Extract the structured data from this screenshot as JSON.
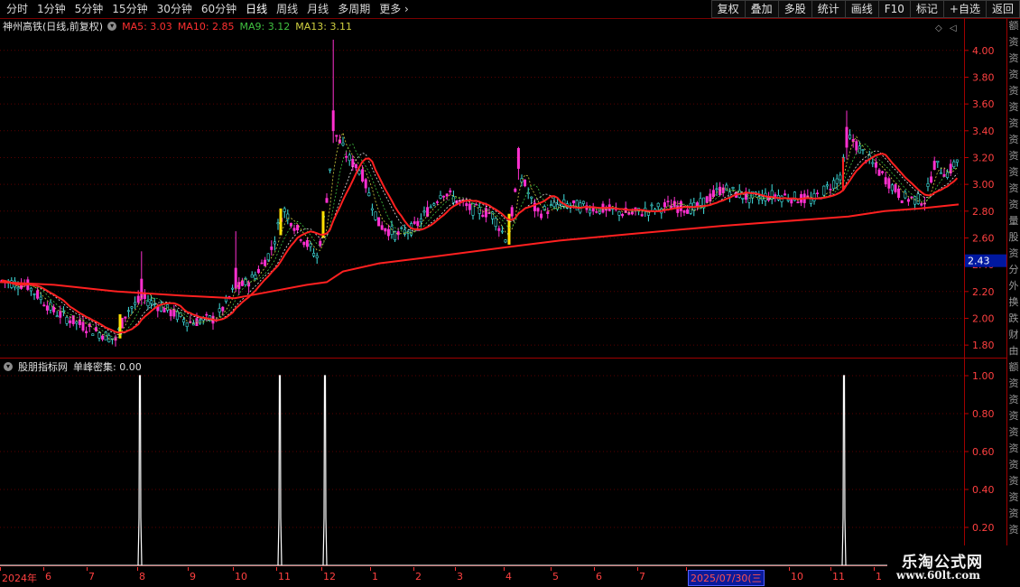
{
  "toolbar": {
    "periods": [
      "分时",
      "1分钟",
      "5分钟",
      "15分钟",
      "30分钟",
      "60分钟",
      "日线",
      "周线",
      "月线",
      "多周期",
      "更多"
    ],
    "active_period": "日线",
    "buttons": [
      "复权",
      "叠加",
      "多股",
      "统计",
      "画线",
      "F10",
      "标记",
      "+自选",
      "返回"
    ]
  },
  "main_legend": {
    "stock": "神州高铁(日线,前复权)",
    "ma5": "MA5: 3.03",
    "ma10": "MA10: 2.85",
    "ma9": "MA9: 3.12",
    "ma13": "MA13: 3.11",
    "colors": {
      "ma5": "#ff3030",
      "ma10": "#ff3030",
      "ma9": "#40c040",
      "ma13": "#d0d040"
    }
  },
  "sub_legend": {
    "source": "股朋指标网",
    "indicator": "单峰密集: 0.00"
  },
  "price_axis": {
    "ticks": [
      "4.00",
      "3.80",
      "3.60",
      "3.40",
      "3.20",
      "3.00",
      "2.80",
      "2.60",
      "2.40",
      "2.20",
      "2.00",
      "1.80"
    ],
    "current": "2.43"
  },
  "indicator_axis": {
    "ticks": [
      "1.00",
      "0.80",
      "0.60",
      "0.40",
      "0.20"
    ]
  },
  "date_axis": {
    "labels": [
      "2024年",
      "6",
      "7",
      "8",
      "9",
      "10",
      "11",
      "12",
      "1",
      "2",
      "3",
      "4",
      "5",
      "6",
      "7",
      "2025/07/30(三",
      "10",
      "11",
      "1"
    ]
  },
  "right_strip": {
    "chars": [
      "额",
      "资",
      "资",
      "资",
      "资",
      "资",
      "资",
      "资",
      "资",
      "资",
      "资",
      "资",
      "量",
      "股",
      "资",
      "分",
      "外",
      "换",
      "跌",
      "财",
      "由",
      "额",
      "资",
      "资",
      "资",
      "资",
      "资",
      "资",
      "资",
      "资",
      "资",
      "资"
    ]
  },
  "watermark": {
    "title": "乐淘公式网",
    "url": "www.60lt.com"
  },
  "chart_data": {
    "type": "candlestick",
    "title": "神州高铁(日线,前复权)",
    "ylim": [
      1.72,
      4.12
    ],
    "series": [
      {
        "name": "MA5",
        "value": 3.03
      },
      {
        "name": "MA10",
        "value": 2.85
      },
      {
        "name": "MA9",
        "value": 3.12
      },
      {
        "name": "MA13",
        "value": 3.11
      }
    ],
    "current_price": 2.43,
    "indicator": {
      "name": "单峰密集",
      "value": 0.0,
      "ylim": [
        0,
        1.0
      ],
      "peaks": [
        1.0,
        1.0,
        1.0,
        1.0
      ]
    }
  }
}
